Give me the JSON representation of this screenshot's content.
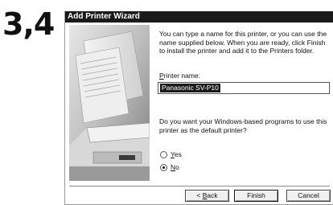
{
  "step_label": "3,4",
  "window": {
    "title": "Add Printer Wizard"
  },
  "description": "You can type a name for this printer, or you can use the name supplied below. When you are ready, click Finish to install the printer and add it to the Printers folder.",
  "printer_name": {
    "label_accel": "P",
    "label_rest": "rinter name:",
    "value": "Panasonic SV-P10"
  },
  "default_question": "Do you want your Windows-based programs to use this printer as the default printer?",
  "default_options": [
    {
      "accel": "Y",
      "rest": "es",
      "selected": false
    },
    {
      "accel": "N",
      "rest": "o",
      "selected": true
    }
  ],
  "buttons": {
    "back_prefix": "< ",
    "back_accel": "B",
    "back_rest": "ack",
    "finish": "Finish",
    "cancel": "Cancel"
  }
}
